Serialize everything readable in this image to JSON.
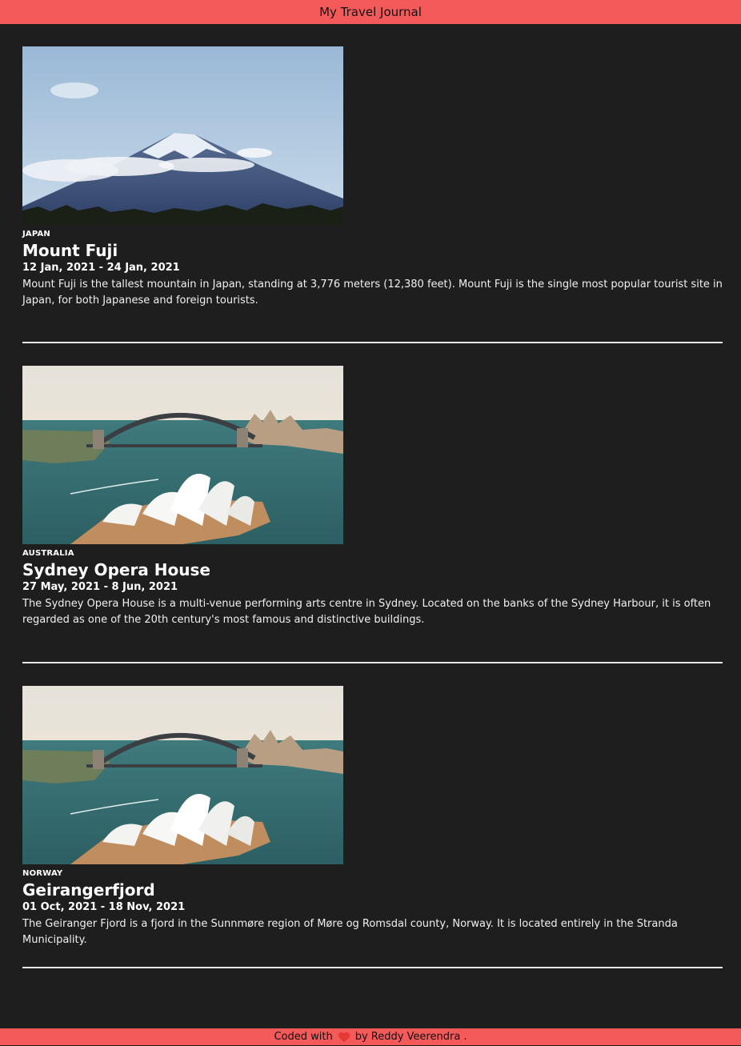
{
  "header": {
    "title": "My Travel Journal"
  },
  "entries": [
    {
      "country": "JAPAN",
      "title": "Mount Fuji",
      "dates": "12 Jan, 2021 - 24 Jan, 2021",
      "description": "Mount Fuji is the tallest mountain in Japan, standing at 3,776 meters (12,380 feet). Mount Fuji is the single most popular tourist site in Japan, for both Japanese and foreign tourists."
    },
    {
      "country": "AUSTRALIA",
      "title": "Sydney Opera House",
      "dates": "27 May, 2021 - 8 Jun, 2021",
      "description": "The Sydney Opera House is a multi-venue performing arts centre in Sydney. Located on the banks of the Sydney Harbour, it is often regarded as one of the 20th century's most famous and distinctive buildings."
    },
    {
      "country": "NORWAY",
      "title": "Geirangerfjord",
      "dates": "01 Oct, 2021 - 18 Nov, 2021",
      "description": "The Geiranger Fjord is a fjord in the Sunnmøre region of Møre og Romsdal county, Norway. It is located entirely in the Stranda Municipality."
    }
  ],
  "footer": {
    "prefix": "Coded with",
    "icon": "heart-icon",
    "suffix": "by Reddy Veerendra ."
  },
  "colors": {
    "accent": "#f55a5a",
    "background": "#1e1e1e",
    "heart": "#e53935"
  }
}
